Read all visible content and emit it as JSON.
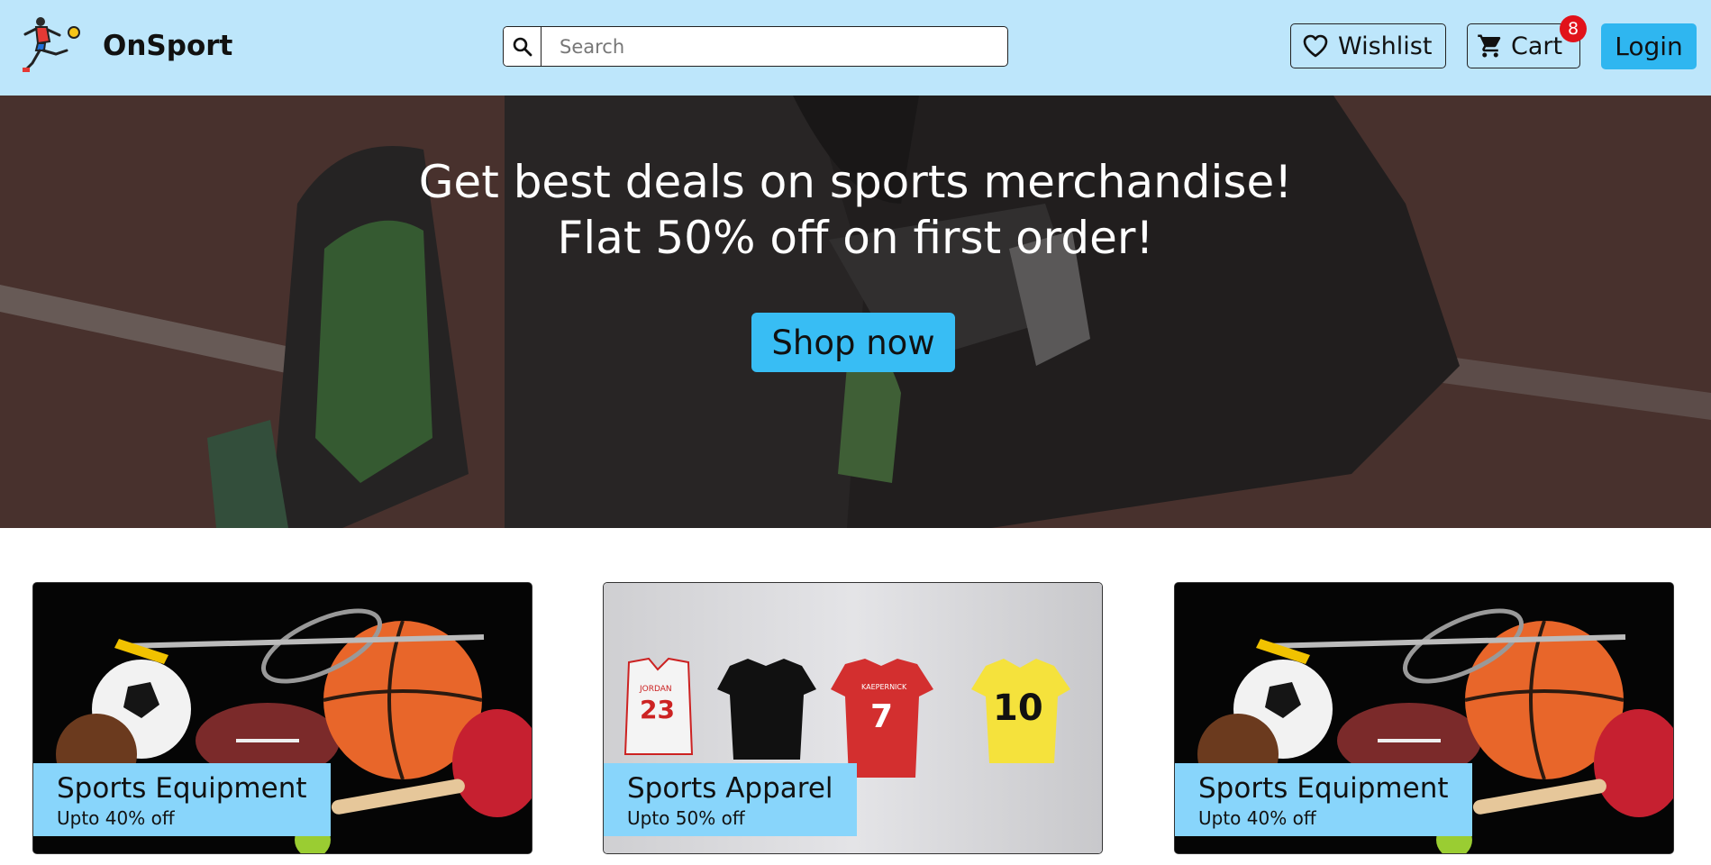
{
  "header": {
    "brand": "OnSport",
    "search": {
      "placeholder": "Search"
    },
    "wishlist_label": "Wishlist",
    "cart_label": "Cart",
    "cart_count": "8",
    "login_label": "Login"
  },
  "hero": {
    "line1": "Get best deals on sports merchandise!",
    "line2": "Flat 50% off on first order!",
    "cta_label": "Shop now"
  },
  "categories": [
    {
      "title": "Sports Equipment",
      "subtitle": "Upto 40% off"
    },
    {
      "title": "Sports Apparel",
      "subtitle": "Upto 50% off"
    },
    {
      "title": "Sports Equipment",
      "subtitle": "Upto 40% off"
    }
  ],
  "jerseys": [
    "JORDAN 23",
    "KAEPERNICK 7",
    "10"
  ],
  "colors": {
    "header_bg": "#bde6fb",
    "accent": "#38bdf4",
    "badge": "#e1121a",
    "card_label_bg": "#88d5fb"
  },
  "icons": [
    "logo-footballer-icon",
    "search-icon",
    "heart-icon",
    "cart-icon"
  ]
}
